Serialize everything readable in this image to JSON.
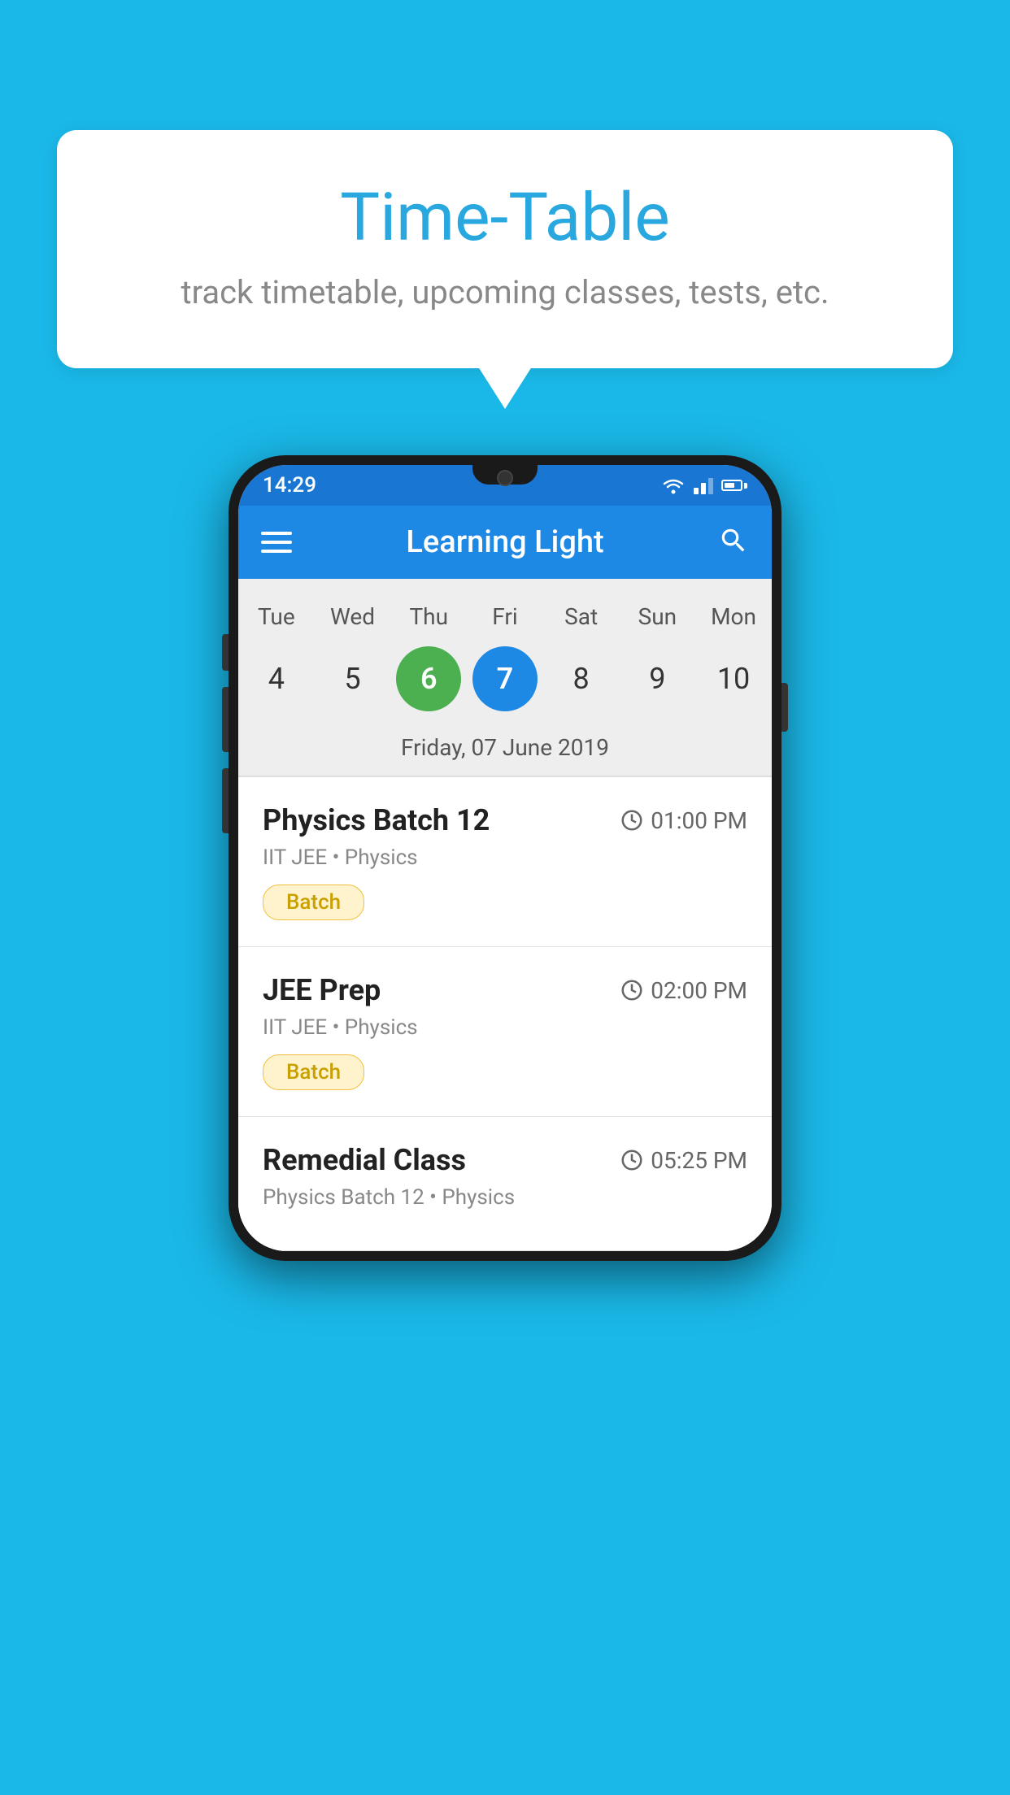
{
  "background_color": "#1ab8e8",
  "bubble": {
    "title": "Time-Table",
    "subtitle": "track timetable, upcoming classes, tests, etc."
  },
  "phone": {
    "status_bar": {
      "time": "14:29"
    },
    "app_bar": {
      "title": "Learning Light"
    },
    "calendar": {
      "days": [
        {
          "name": "Tue",
          "num": "4",
          "state": "normal"
        },
        {
          "name": "Wed",
          "num": "5",
          "state": "normal"
        },
        {
          "name": "Thu",
          "num": "6",
          "state": "today"
        },
        {
          "name": "Fri",
          "num": "7",
          "state": "selected"
        },
        {
          "name": "Sat",
          "num": "8",
          "state": "normal"
        },
        {
          "name": "Sun",
          "num": "9",
          "state": "normal"
        },
        {
          "name": "Mon",
          "num": "10",
          "state": "normal"
        }
      ],
      "selected_date_label": "Friday, 07 June 2019"
    },
    "schedule": [
      {
        "title": "Physics Batch 12",
        "time": "01:00 PM",
        "subtitle": "IIT JEE • Physics",
        "badge": "Batch"
      },
      {
        "title": "JEE Prep",
        "time": "02:00 PM",
        "subtitle": "IIT JEE • Physics",
        "badge": "Batch"
      },
      {
        "title": "Remedial Class",
        "time": "05:25 PM",
        "subtitle": "Physics Batch 12 • Physics",
        "badge": null
      }
    ]
  }
}
